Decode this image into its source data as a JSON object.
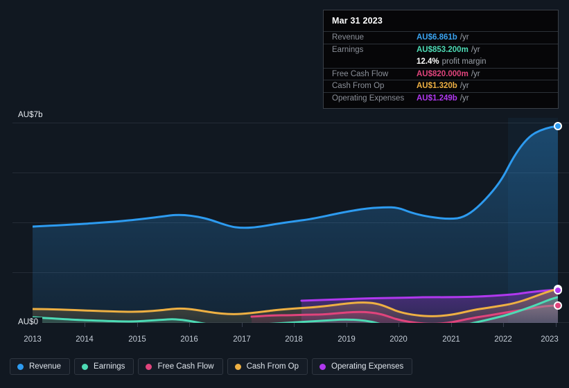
{
  "axes": {
    "y_top_label": "AU$7b",
    "y_bottom_label": "AU$0",
    "x_labels": [
      "2013",
      "2014",
      "2015",
      "2016",
      "2017",
      "2018",
      "2019",
      "2020",
      "2021",
      "2022",
      "2023"
    ]
  },
  "tooltip": {
    "date": "Mar 31 2023",
    "rows": [
      {
        "label": "Revenue",
        "value": "AU$6.861b",
        "unit": "/yr",
        "color": "#3aa3ef"
      },
      {
        "label": "Earnings",
        "value": "AU$853.200m",
        "unit": "/yr",
        "color": "#4ddbb5"
      },
      {
        "label": "",
        "value": "12.4%",
        "unit": "profit margin",
        "color": "#ffffff"
      },
      {
        "label": "Free Cash Flow",
        "value": "AU$820.000m",
        "unit": "/yr",
        "color": "#e0447c"
      },
      {
        "label": "Cash From Op",
        "value": "AU$1.320b",
        "unit": "/yr",
        "color": "#eeb043"
      },
      {
        "label": "Operating Expenses",
        "value": "AU$1.249b",
        "unit": "/yr",
        "color": "#b038ef"
      }
    ]
  },
  "legend": {
    "items": [
      {
        "label": "Revenue",
        "color": "#2d9bf0"
      },
      {
        "label": "Earnings",
        "color": "#4ddbb5"
      },
      {
        "label": "Free Cash Flow",
        "color": "#e0447c"
      },
      {
        "label": "Cash From Op",
        "color": "#eeb043"
      },
      {
        "label": "Operating Expenses",
        "color": "#b038ef"
      }
    ]
  },
  "chart_data": {
    "type": "area",
    "title": "",
    "xlabel": "",
    "ylabel": "AU$",
    "ylim": [
      0,
      7
    ],
    "y_unit": "billions AUD",
    "grid": true,
    "legend_position": "bottom",
    "x": [
      2013,
      2013.5,
      2014,
      2014.5,
      2015,
      2015.5,
      2016,
      2016.5,
      2017,
      2017.5,
      2018,
      2018.5,
      2019,
      2019.5,
      2020,
      2020.5,
      2021,
      2021.5,
      2022,
      2022.5,
      2023
    ],
    "series": [
      {
        "name": "Revenue",
        "color": "#2d9bf0",
        "values": [
          3.36,
          3.38,
          3.4,
          3.42,
          3.38,
          3.52,
          3.54,
          3.4,
          3.38,
          3.44,
          3.52,
          3.7,
          3.8,
          3.9,
          4.02,
          3.95,
          3.88,
          4.55,
          5.3,
          6.35,
          6.861
        ]
      },
      {
        "name": "Earnings",
        "color": "#4ddbb5",
        "values": [
          0.17,
          0.2,
          0.23,
          0.22,
          0.2,
          0.24,
          0.22,
          0.15,
          0.14,
          0.16,
          0.19,
          0.21,
          0.22,
          0.18,
          0.21,
          0.15,
          0.05,
          0.17,
          0.35,
          0.62,
          0.853
        ]
      },
      {
        "name": "Free Cash Flow",
        "color": "#e0447c",
        "start_x": 2016.55,
        "values": [
          null,
          null,
          null,
          null,
          null,
          null,
          null,
          0.21,
          0.24,
          0.25,
          0.26,
          0.3,
          0.32,
          0.28,
          0.31,
          0.22,
          0.11,
          0.22,
          0.38,
          0.6,
          0.82
        ]
      },
      {
        "name": "Cash From Op",
        "color": "#eeb043",
        "values": [
          0.47,
          0.46,
          0.45,
          0.44,
          0.43,
          0.48,
          0.47,
          0.42,
          0.41,
          0.46,
          0.49,
          0.53,
          0.55,
          0.52,
          0.62,
          0.5,
          0.38,
          0.52,
          0.7,
          1.05,
          1.32
        ]
      },
      {
        "name": "Operating Expenses",
        "color": "#b038ef",
        "start_x": 2018.35,
        "values": [
          null,
          null,
          null,
          null,
          null,
          null,
          null,
          null,
          null,
          null,
          null,
          0.76,
          0.79,
          0.8,
          0.82,
          0.83,
          0.84,
          0.88,
          0.95,
          1.1,
          1.249
        ]
      }
    ],
    "annotations": {
      "highlight_band_start_x": 2022.35,
      "endpoint_markers": [
        "Revenue",
        "Cash From Op",
        "Operating Expenses",
        "Free Cash Flow"
      ]
    }
  }
}
